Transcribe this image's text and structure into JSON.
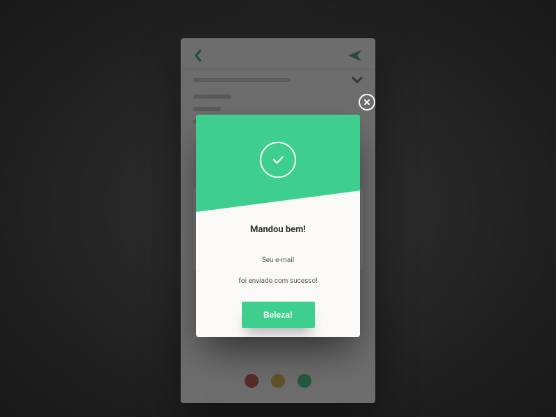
{
  "colors": {
    "accent": "#3ecf8e",
    "dot_red": "#b83a3a",
    "dot_yellow": "#c9a33a",
    "dot_green": "#2fb574"
  },
  "modal": {
    "title": "Mandou bem!",
    "body_line1": "Seu e-mail",
    "body_line2": "foi enviado com sucesso!",
    "confirm_label": "Beleza!"
  }
}
